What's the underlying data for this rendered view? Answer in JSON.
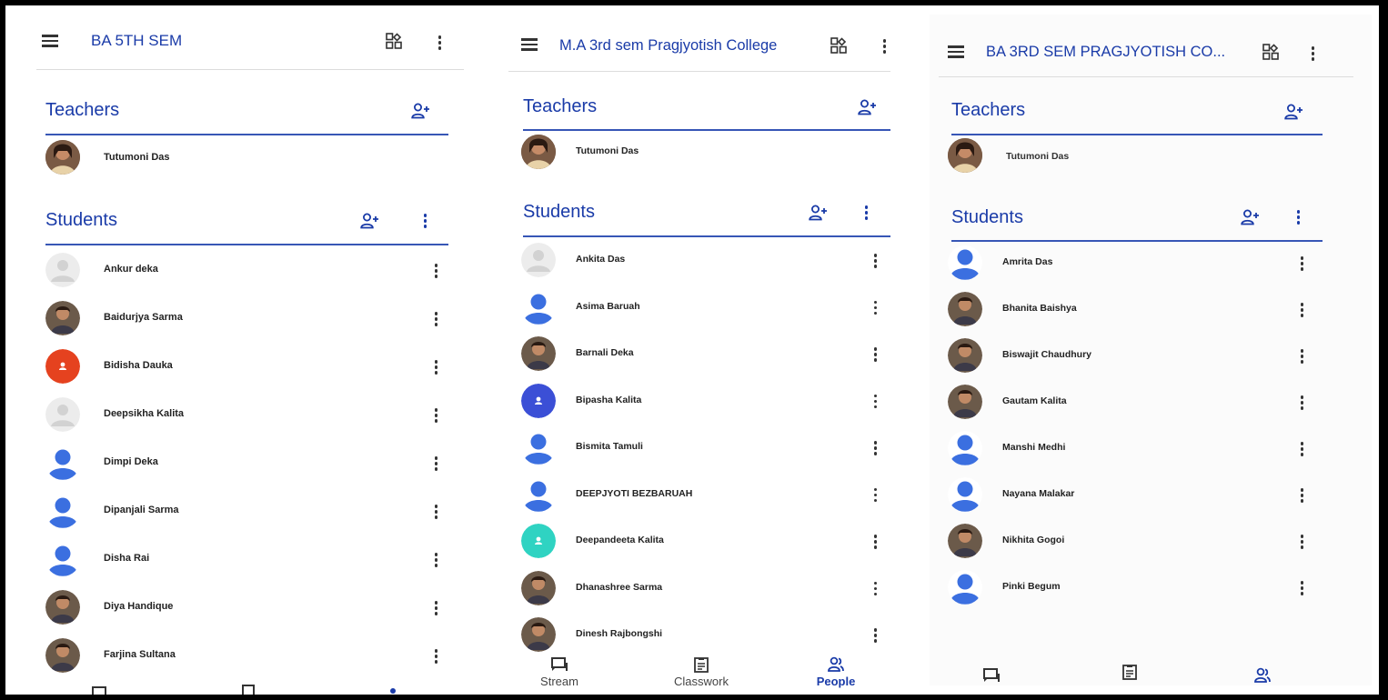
{
  "colors": {
    "accent": "#1a3ba8",
    "frame": "#000000",
    "avatar_blue": "#3b6fe0",
    "avatar_red": "#e5421f",
    "avatar_indigo": "#3b4fd6",
    "avatar_teal": "#2fd3c2"
  },
  "panels": [
    {
      "title": "BA 5TH SEM",
      "teachers_heading": "Teachers",
      "students_heading": "Students",
      "teachers": [
        {
          "name": "Tutumoni Das",
          "avatar": "photo"
        }
      ],
      "students": [
        {
          "name": "Ankur deka",
          "avatar": "gray"
        },
        {
          "name": "Baidurjya Sarma",
          "avatar": "photo"
        },
        {
          "name": "Bidisha Dauka",
          "avatar": "red"
        },
        {
          "name": "Deepsikha Kalita",
          "avatar": "gray"
        },
        {
          "name": "Dimpi Deka",
          "avatar": "blue"
        },
        {
          "name": "Dipanjali Sarma",
          "avatar": "blue"
        },
        {
          "name": "Disha Rai",
          "avatar": "blue"
        },
        {
          "name": "Diya Handique",
          "avatar": "photo"
        },
        {
          "name": "Farjina Sultana",
          "avatar": "photo"
        }
      ]
    },
    {
      "title": "M.A 3rd sem Pragjyotish College",
      "teachers_heading": "Teachers",
      "students_heading": "Students",
      "teachers": [
        {
          "name": "Tutumoni Das",
          "avatar": "photo"
        }
      ],
      "students": [
        {
          "name": "Ankita Das",
          "avatar": "gray"
        },
        {
          "name": "Asima Baruah",
          "avatar": "blue"
        },
        {
          "name": "Barnali Deka",
          "avatar": "photo"
        },
        {
          "name": "Bipasha Kalita",
          "avatar": "indigo"
        },
        {
          "name": "Bismita Tamuli",
          "avatar": "blue"
        },
        {
          "name": "DEEPJYOTI BEZBARUAH",
          "avatar": "blue"
        },
        {
          "name": "Deepandeeta Kalita",
          "avatar": "teal"
        },
        {
          "name": "Dhanashree Sarma",
          "avatar": "photo"
        },
        {
          "name": "Dinesh Rajbongshi",
          "avatar": "photo"
        }
      ],
      "nav": [
        {
          "label": "Stream",
          "icon": "stream-icon",
          "active": false
        },
        {
          "label": "Classwork",
          "icon": "classwork-icon",
          "active": false
        },
        {
          "label": "People",
          "icon": "people-icon",
          "active": true
        }
      ]
    },
    {
      "title": "BA 3RD SEM PRAGJYOTISH CO...",
      "teachers_heading": "Teachers",
      "students_heading": "Students",
      "teachers": [
        {
          "name": "Tutumoni Das",
          "avatar": "photo"
        }
      ],
      "students": [
        {
          "name": "Amrita Das",
          "avatar": "blue"
        },
        {
          "name": "Bhanita Baishya",
          "avatar": "photo"
        },
        {
          "name": "Biswajit Chaudhury",
          "avatar": "photo"
        },
        {
          "name": "Gautam Kalita",
          "avatar": "photo"
        },
        {
          "name": "Manshi Medhi",
          "avatar": "blue"
        },
        {
          "name": "Nayana Malakar",
          "avatar": "blue"
        },
        {
          "name": "Nikhita Gogoi",
          "avatar": "photo"
        },
        {
          "name": "Pinki Begum",
          "avatar": "blue"
        }
      ]
    }
  ]
}
